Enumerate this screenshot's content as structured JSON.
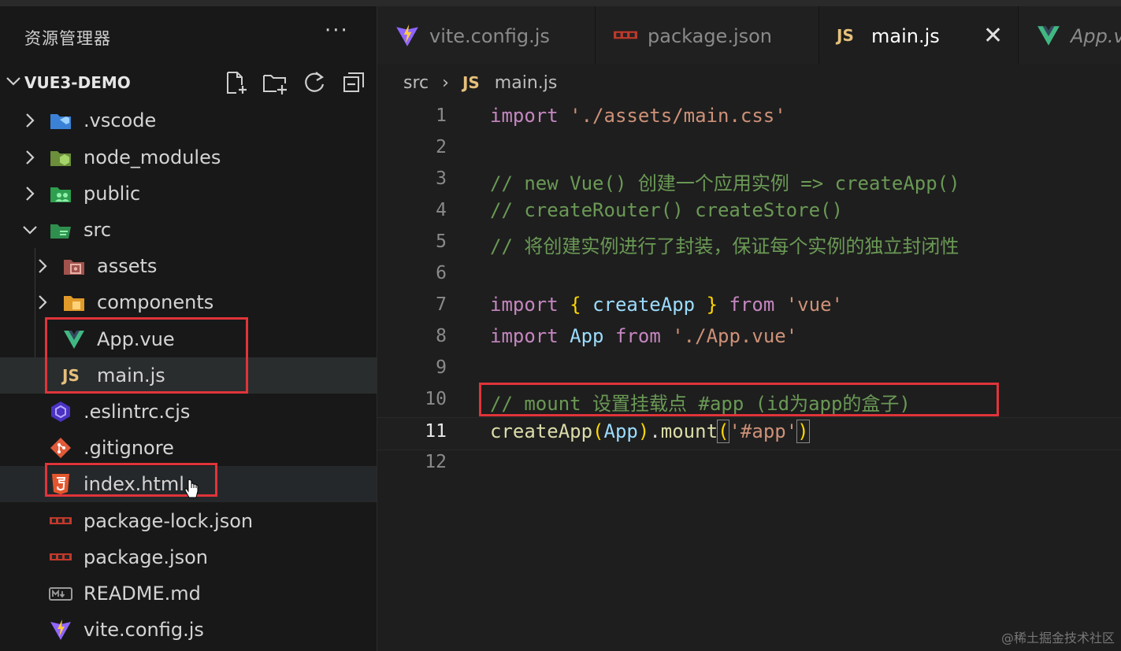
{
  "sidebar": {
    "title": "资源管理器",
    "more": "···",
    "project": "VUE3-DEMO",
    "actions": [
      "new-file-icon",
      "new-folder-icon",
      "refresh-icon",
      "collapse-all-icon"
    ],
    "tree": [
      {
        "label": ".vscode",
        "type": "folder",
        "icon": "vscode-folder-icon"
      },
      {
        "label": "node_modules",
        "type": "folder",
        "icon": "node-folder-icon"
      },
      {
        "label": "public",
        "type": "folder",
        "icon": "public-folder-icon"
      },
      {
        "label": "src",
        "type": "folder",
        "icon": "src-folder-icon",
        "expanded": true
      },
      {
        "label": "assets",
        "type": "folder",
        "icon": "assets-folder-icon"
      },
      {
        "label": "components",
        "type": "folder",
        "icon": "components-folder-icon"
      },
      {
        "label": "App.vue",
        "type": "file",
        "icon": "vue-icon"
      },
      {
        "label": "main.js",
        "type": "file",
        "icon": "js-icon",
        "active": true
      },
      {
        "label": ".eslintrc.cjs",
        "type": "file",
        "icon": "eslint-icon"
      },
      {
        "label": ".gitignore",
        "type": "file",
        "icon": "git-icon"
      },
      {
        "label": "index.html",
        "type": "file",
        "icon": "html-icon"
      },
      {
        "label": "package-lock.json",
        "type": "file",
        "icon": "npm-icon"
      },
      {
        "label": "package.json",
        "type": "file",
        "icon": "npm-icon"
      },
      {
        "label": "README.md",
        "type": "file",
        "icon": "markdown-icon"
      },
      {
        "label": "vite.config.js",
        "type": "file",
        "icon": "vite-icon"
      }
    ]
  },
  "tabs": [
    {
      "label": "vite.config.js",
      "icon": "vite-icon"
    },
    {
      "label": "package.json",
      "icon": "npm-icon"
    },
    {
      "label": "main.js",
      "icon": "js-icon",
      "active": true,
      "close": "✕"
    },
    {
      "label": "App.v",
      "icon": "vue-icon"
    }
  ],
  "breadcrumb": {
    "folder": "src",
    "sep": "›",
    "icon_text": "JS",
    "file": "main.js"
  },
  "editor": {
    "current_line": 11,
    "lines": [
      {
        "n": "1",
        "text": "import './assets/main.css'"
      },
      {
        "n": "2",
        "text": ""
      },
      {
        "n": "3",
        "text": "// new Vue() 创建一个应用实例 => createApp()"
      },
      {
        "n": "4",
        "text": "// createRouter() createStore()"
      },
      {
        "n": "5",
        "text": "// 将创建实例进行了封装，保证每个实例的独立封闭性"
      },
      {
        "n": "6",
        "text": ""
      },
      {
        "n": "7",
        "text": "import { createApp } from 'vue'"
      },
      {
        "n": "8",
        "text": "import App from './App.vue'"
      },
      {
        "n": "9",
        "text": ""
      },
      {
        "n": "10",
        "text": "// mount 设置挂载点 #app (id为app的盒子)"
      },
      {
        "n": "11",
        "text": "createApp(App).mount('#app')"
      },
      {
        "n": "12",
        "text": ""
      }
    ]
  },
  "js_badge": "JS",
  "watermark": "@稀土掘金技术社区",
  "colors": {
    "highlight": "#e0343a",
    "keyword": "#c586c0",
    "string": "#ce9178",
    "comment": "#6a9955",
    "function": "#dcdcaa",
    "variable": "#9cdcfe",
    "js_yellow": "#e5c07b",
    "vue_green": "#41b883"
  }
}
